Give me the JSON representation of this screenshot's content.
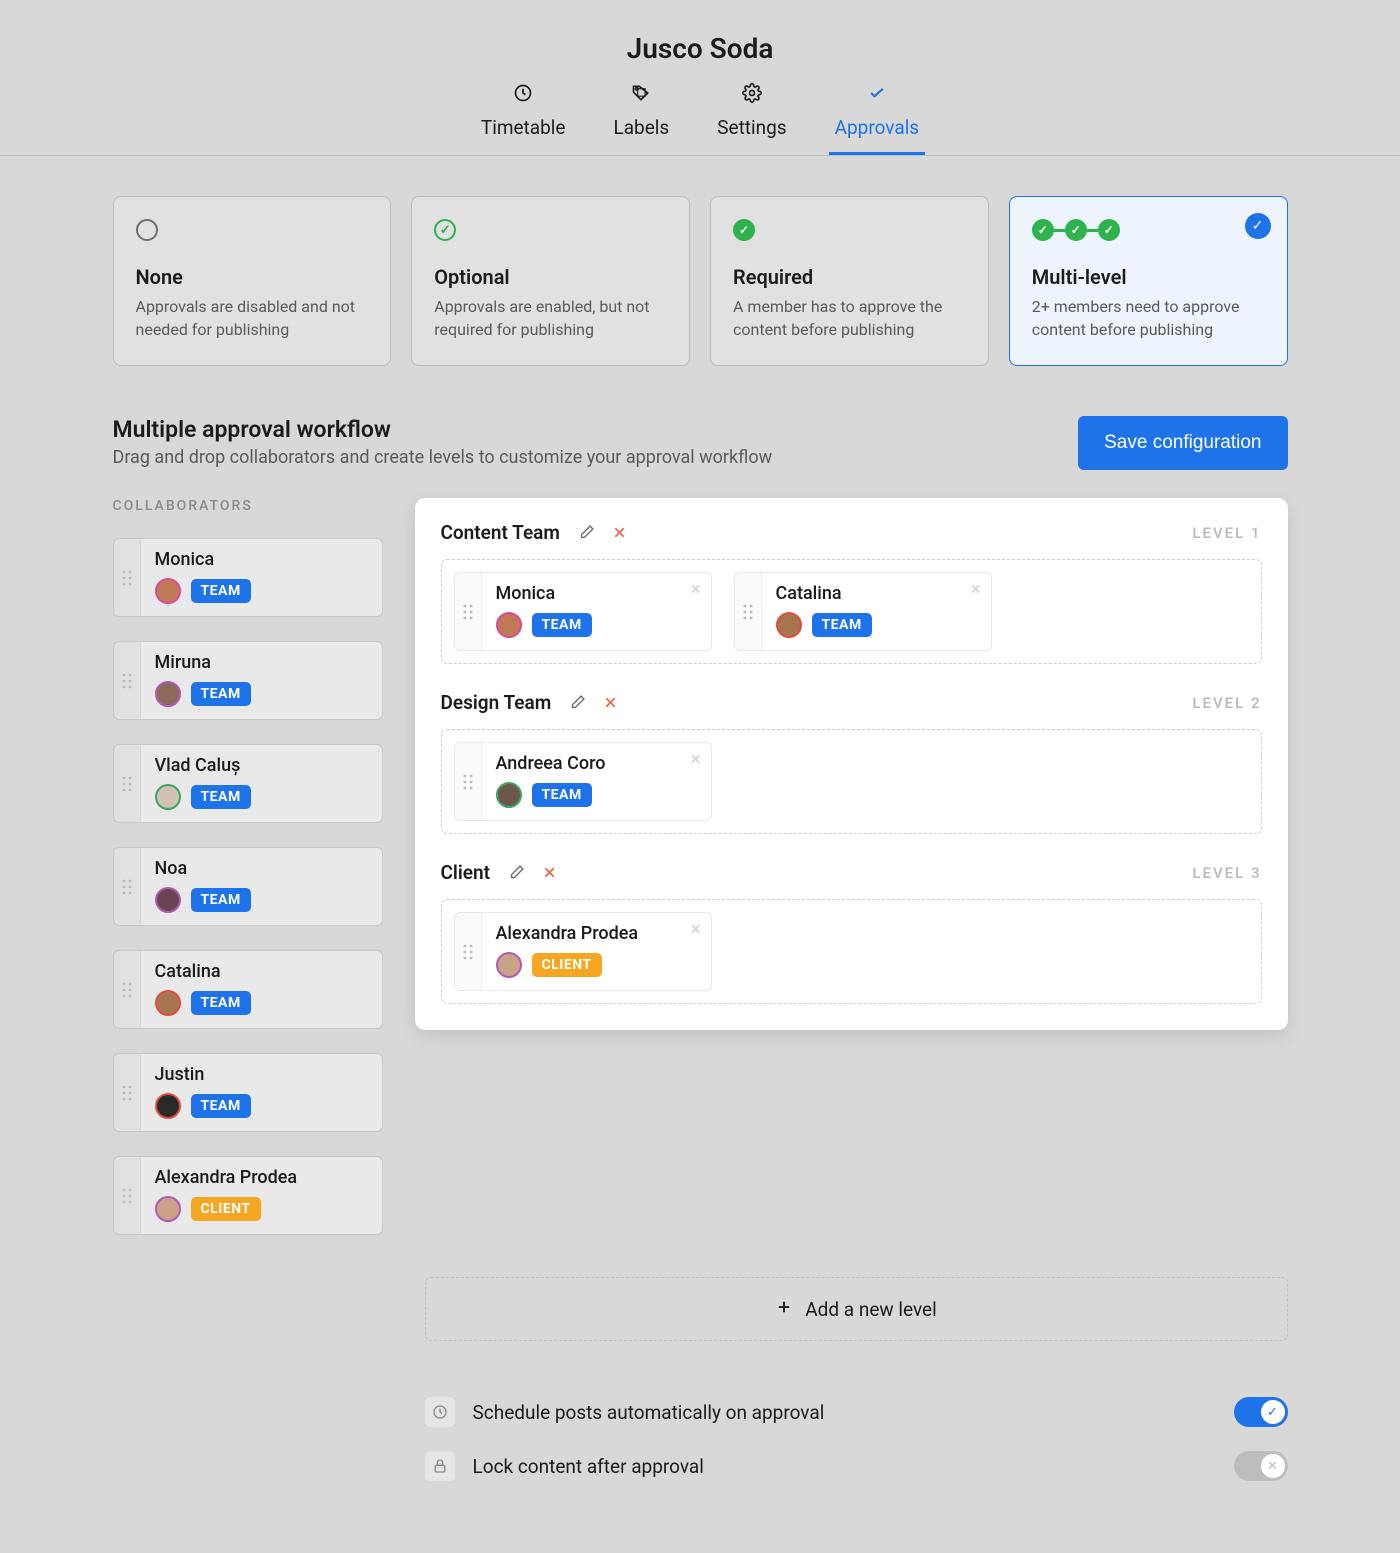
{
  "header": {
    "title": "Jusco Soda"
  },
  "tabs": {
    "timetable": "Timetable",
    "labels": "Labels",
    "settings": "Settings",
    "approvals": "Approvals",
    "active": "approvals"
  },
  "options": {
    "none": {
      "title": "None",
      "desc": "Approvals are disabled and not needed for publishing"
    },
    "optional": {
      "title": "Optional",
      "desc": "Approvals are enabled, but not required for publishing"
    },
    "required": {
      "title": "Required",
      "desc": "A member has to approve the content before publishing"
    },
    "multi": {
      "title": "Multi-level",
      "desc": "2+ members need to approve content before publishing"
    }
  },
  "section": {
    "title": "Multiple approval workflow",
    "subtitle": "Drag and drop collaborators and create levels to customize your approval workflow",
    "save": "Save configuration"
  },
  "sidebar": {
    "label": "COLLABORATORS",
    "items": [
      {
        "name": "Monica",
        "role": "TEAM",
        "roleClass": "role-team",
        "avatarBorder": "#d94b9a",
        "avatarFill": "#c07a58"
      },
      {
        "name": "Miruna",
        "role": "TEAM",
        "roleClass": "role-team",
        "avatarBorder": "#b05bb8",
        "avatarFill": "#8c6a5a"
      },
      {
        "name": "Vlad Caluș",
        "role": "TEAM",
        "roleClass": "role-team",
        "avatarBorder": "#3aa765",
        "avatarFill": "#d0c3b3"
      },
      {
        "name": "Noa",
        "role": "TEAM",
        "roleClass": "role-team",
        "avatarBorder": "#b05bb8",
        "avatarFill": "#6a4452"
      },
      {
        "name": "Catalina",
        "role": "TEAM",
        "roleClass": "role-team",
        "avatarBorder": "#e04e3e",
        "avatarFill": "#a67650"
      },
      {
        "name": "Justin",
        "role": "TEAM",
        "roleClass": "role-team",
        "avatarBorder": "#e04e3e",
        "avatarFill": "#2a2a2a"
      },
      {
        "name": "Alexandra Prodea",
        "role": "CLIENT",
        "roleClass": "role-client",
        "avatarBorder": "#b05bb8",
        "avatarFill": "#caa288"
      }
    ]
  },
  "levels": [
    {
      "title": "Content Team",
      "label": "LEVEL 1",
      "members": [
        {
          "name": "Monica",
          "role": "TEAM",
          "roleClass": "role-team",
          "avatarBorder": "#d94b9a",
          "avatarFill": "#c07a58"
        },
        {
          "name": "Catalina",
          "role": "TEAM",
          "roleClass": "role-team",
          "avatarBorder": "#e04e3e",
          "avatarFill": "#a67650"
        }
      ]
    },
    {
      "title": "Design Team",
      "label": "LEVEL 2",
      "members": [
        {
          "name": "Andreea Coro",
          "role": "TEAM",
          "roleClass": "role-team",
          "avatarBorder": "#3aa765",
          "avatarFill": "#6b584a"
        }
      ]
    },
    {
      "title": "Client",
      "label": "LEVEL 3",
      "members": [
        {
          "name": "Alexandra Prodea",
          "role": "CLIENT",
          "roleClass": "role-client",
          "avatarBorder": "#b05bb8",
          "avatarFill": "#caa288"
        }
      ]
    }
  ],
  "addLevel": "Add a new level",
  "settings": {
    "schedule": {
      "label": "Schedule posts automatically on approval",
      "on": true
    },
    "lock": {
      "label": "Lock content after approval",
      "on": false
    }
  }
}
